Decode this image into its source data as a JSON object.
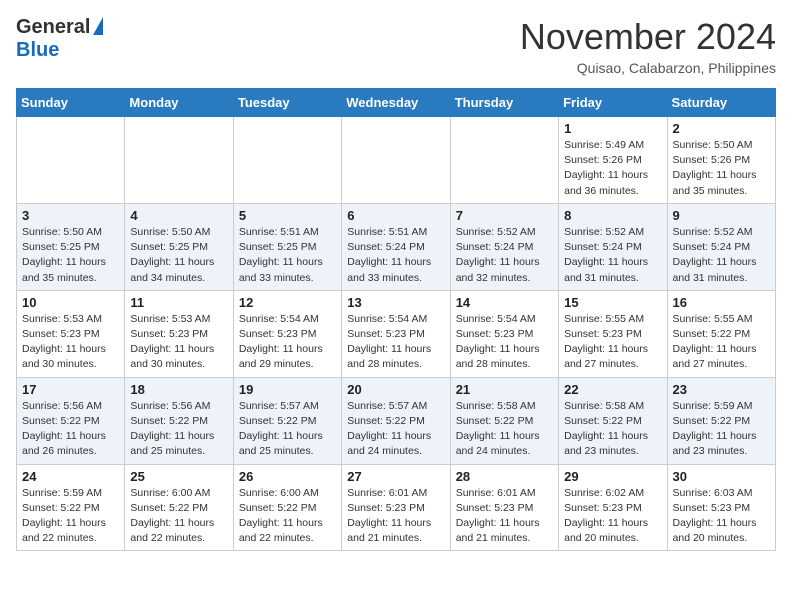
{
  "header": {
    "logo_general": "General",
    "logo_blue": "Blue",
    "month": "November 2024",
    "location": "Quisao, Calabarzon, Philippines"
  },
  "weekdays": [
    "Sunday",
    "Monday",
    "Tuesday",
    "Wednesday",
    "Thursday",
    "Friday",
    "Saturday"
  ],
  "weeks": [
    [
      {
        "day": "",
        "info": ""
      },
      {
        "day": "",
        "info": ""
      },
      {
        "day": "",
        "info": ""
      },
      {
        "day": "",
        "info": ""
      },
      {
        "day": "",
        "info": ""
      },
      {
        "day": "1",
        "info": "Sunrise: 5:49 AM\nSunset: 5:26 PM\nDaylight: 11 hours\nand 36 minutes."
      },
      {
        "day": "2",
        "info": "Sunrise: 5:50 AM\nSunset: 5:26 PM\nDaylight: 11 hours\nand 35 minutes."
      }
    ],
    [
      {
        "day": "3",
        "info": "Sunrise: 5:50 AM\nSunset: 5:25 PM\nDaylight: 11 hours\nand 35 minutes."
      },
      {
        "day": "4",
        "info": "Sunrise: 5:50 AM\nSunset: 5:25 PM\nDaylight: 11 hours\nand 34 minutes."
      },
      {
        "day": "5",
        "info": "Sunrise: 5:51 AM\nSunset: 5:25 PM\nDaylight: 11 hours\nand 33 minutes."
      },
      {
        "day": "6",
        "info": "Sunrise: 5:51 AM\nSunset: 5:24 PM\nDaylight: 11 hours\nand 33 minutes."
      },
      {
        "day": "7",
        "info": "Sunrise: 5:52 AM\nSunset: 5:24 PM\nDaylight: 11 hours\nand 32 minutes."
      },
      {
        "day": "8",
        "info": "Sunrise: 5:52 AM\nSunset: 5:24 PM\nDaylight: 11 hours\nand 31 minutes."
      },
      {
        "day": "9",
        "info": "Sunrise: 5:52 AM\nSunset: 5:24 PM\nDaylight: 11 hours\nand 31 minutes."
      }
    ],
    [
      {
        "day": "10",
        "info": "Sunrise: 5:53 AM\nSunset: 5:23 PM\nDaylight: 11 hours\nand 30 minutes."
      },
      {
        "day": "11",
        "info": "Sunrise: 5:53 AM\nSunset: 5:23 PM\nDaylight: 11 hours\nand 30 minutes."
      },
      {
        "day": "12",
        "info": "Sunrise: 5:54 AM\nSunset: 5:23 PM\nDaylight: 11 hours\nand 29 minutes."
      },
      {
        "day": "13",
        "info": "Sunrise: 5:54 AM\nSunset: 5:23 PM\nDaylight: 11 hours\nand 28 minutes."
      },
      {
        "day": "14",
        "info": "Sunrise: 5:54 AM\nSunset: 5:23 PM\nDaylight: 11 hours\nand 28 minutes."
      },
      {
        "day": "15",
        "info": "Sunrise: 5:55 AM\nSunset: 5:23 PM\nDaylight: 11 hours\nand 27 minutes."
      },
      {
        "day": "16",
        "info": "Sunrise: 5:55 AM\nSunset: 5:22 PM\nDaylight: 11 hours\nand 27 minutes."
      }
    ],
    [
      {
        "day": "17",
        "info": "Sunrise: 5:56 AM\nSunset: 5:22 PM\nDaylight: 11 hours\nand 26 minutes."
      },
      {
        "day": "18",
        "info": "Sunrise: 5:56 AM\nSunset: 5:22 PM\nDaylight: 11 hours\nand 25 minutes."
      },
      {
        "day": "19",
        "info": "Sunrise: 5:57 AM\nSunset: 5:22 PM\nDaylight: 11 hours\nand 25 minutes."
      },
      {
        "day": "20",
        "info": "Sunrise: 5:57 AM\nSunset: 5:22 PM\nDaylight: 11 hours\nand 24 minutes."
      },
      {
        "day": "21",
        "info": "Sunrise: 5:58 AM\nSunset: 5:22 PM\nDaylight: 11 hours\nand 24 minutes."
      },
      {
        "day": "22",
        "info": "Sunrise: 5:58 AM\nSunset: 5:22 PM\nDaylight: 11 hours\nand 23 minutes."
      },
      {
        "day": "23",
        "info": "Sunrise: 5:59 AM\nSunset: 5:22 PM\nDaylight: 11 hours\nand 23 minutes."
      }
    ],
    [
      {
        "day": "24",
        "info": "Sunrise: 5:59 AM\nSunset: 5:22 PM\nDaylight: 11 hours\nand 22 minutes."
      },
      {
        "day": "25",
        "info": "Sunrise: 6:00 AM\nSunset: 5:22 PM\nDaylight: 11 hours\nand 22 minutes."
      },
      {
        "day": "26",
        "info": "Sunrise: 6:00 AM\nSunset: 5:22 PM\nDaylight: 11 hours\nand 22 minutes."
      },
      {
        "day": "27",
        "info": "Sunrise: 6:01 AM\nSunset: 5:23 PM\nDaylight: 11 hours\nand 21 minutes."
      },
      {
        "day": "28",
        "info": "Sunrise: 6:01 AM\nSunset: 5:23 PM\nDaylight: 11 hours\nand 21 minutes."
      },
      {
        "day": "29",
        "info": "Sunrise: 6:02 AM\nSunset: 5:23 PM\nDaylight: 11 hours\nand 20 minutes."
      },
      {
        "day": "30",
        "info": "Sunrise: 6:03 AM\nSunset: 5:23 PM\nDaylight: 11 hours\nand 20 minutes."
      }
    ]
  ]
}
